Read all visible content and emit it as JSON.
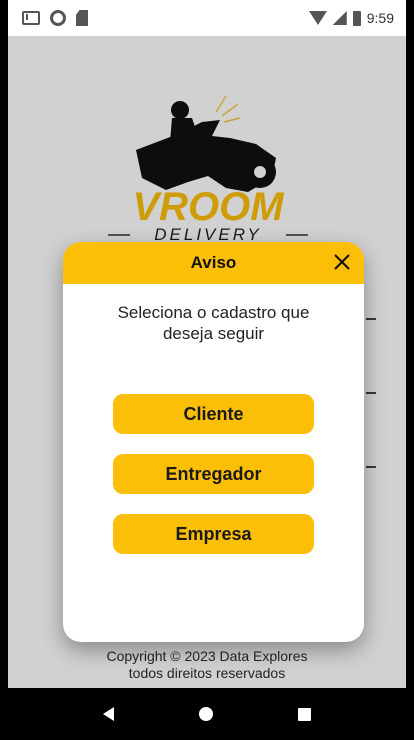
{
  "status_bar": {
    "time": "9:59",
    "left_icons": [
      "mail-icon",
      "circle-icon",
      "sd-card-icon"
    ],
    "right_icons": [
      "wifi-icon",
      "signal-icon",
      "battery-icon"
    ]
  },
  "logo": {
    "brand": "VROOM",
    "tagline": "DELIVERY"
  },
  "dialog": {
    "title": "Aviso",
    "close_icon": "close-icon",
    "message": "Seleciona o cadastro que deseja seguir",
    "options": [
      "Cliente",
      "Entregador",
      "Empresa"
    ]
  },
  "footer": {
    "line1": "Copyright © 2023 Data Explores",
    "line2": "todos direitos reservados"
  },
  "nav_bar": {
    "icons": [
      "back-icon",
      "home-icon",
      "recents-icon"
    ]
  },
  "colors": {
    "accent": "#fbbf08",
    "nav_background": "#000000"
  }
}
